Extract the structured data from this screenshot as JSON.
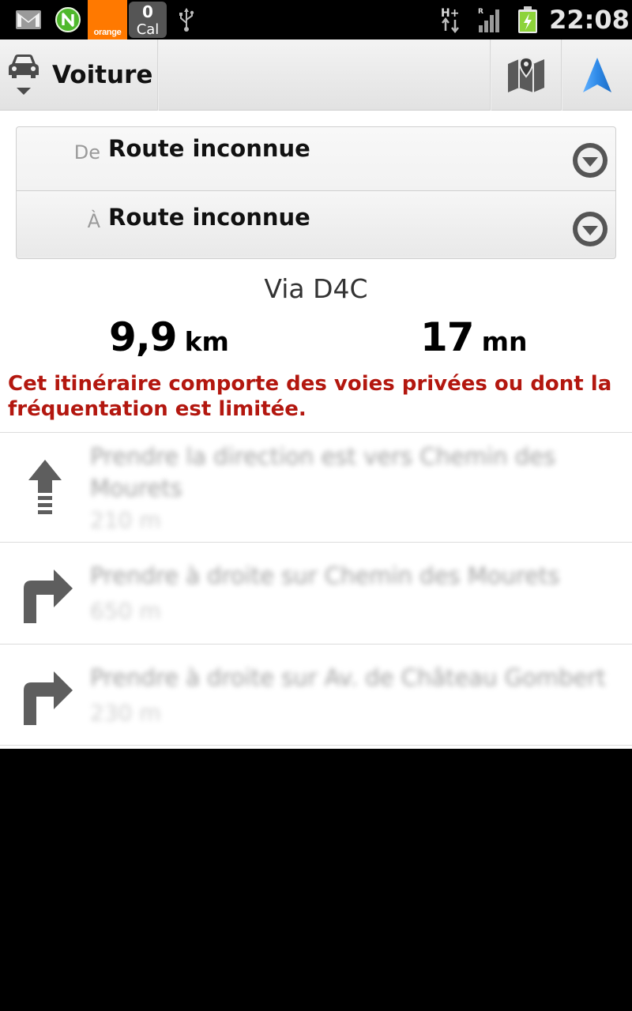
{
  "status_bar": {
    "carrier": "orange",
    "cal_count": "0",
    "cal_label": "Cal",
    "time": "22:08",
    "icons": [
      "gmail-icon",
      "n-app-icon",
      "orange-carrier-icon",
      "calendar-badge-icon",
      "usb-icon",
      "hplus-data-icon",
      "signal-icon",
      "battery-charging-icon"
    ]
  },
  "action_bar": {
    "mode_label": "Voiture",
    "mode_icon": "car-icon",
    "map_icon": "map-icon",
    "navigation_icon": "navigation-arrow-icon"
  },
  "route": {
    "from_prefix": "De",
    "from_value": "Route inconnue",
    "to_prefix": "À",
    "to_value": "Route inconnue"
  },
  "summary": {
    "via": "Via D4C",
    "distance_value": "9,9",
    "distance_unit": "km",
    "duration_value": "17",
    "duration_unit": "mn",
    "warning": "Cet itinéraire comporte des voies privées ou dont la fréquentation est limitée."
  },
  "steps": [
    {
      "icon": "straight-arrow-icon",
      "instruction": "Prendre la direction est vers Chemin des Mourets",
      "distance": "210 m"
    },
    {
      "icon": "turn-right-icon",
      "instruction": "Prendre à droite sur Chemin des Mourets",
      "distance": "650 m"
    },
    {
      "icon": "turn-right-icon",
      "instruction": "Prendre à droite sur Av. de Château Gombert",
      "distance": "230 m"
    }
  ],
  "colors": {
    "warning": "#b3170f",
    "carrier_orange": "#ff7900",
    "nav_blue": "#2f8ae8",
    "battery_green": "#8dd33a"
  }
}
